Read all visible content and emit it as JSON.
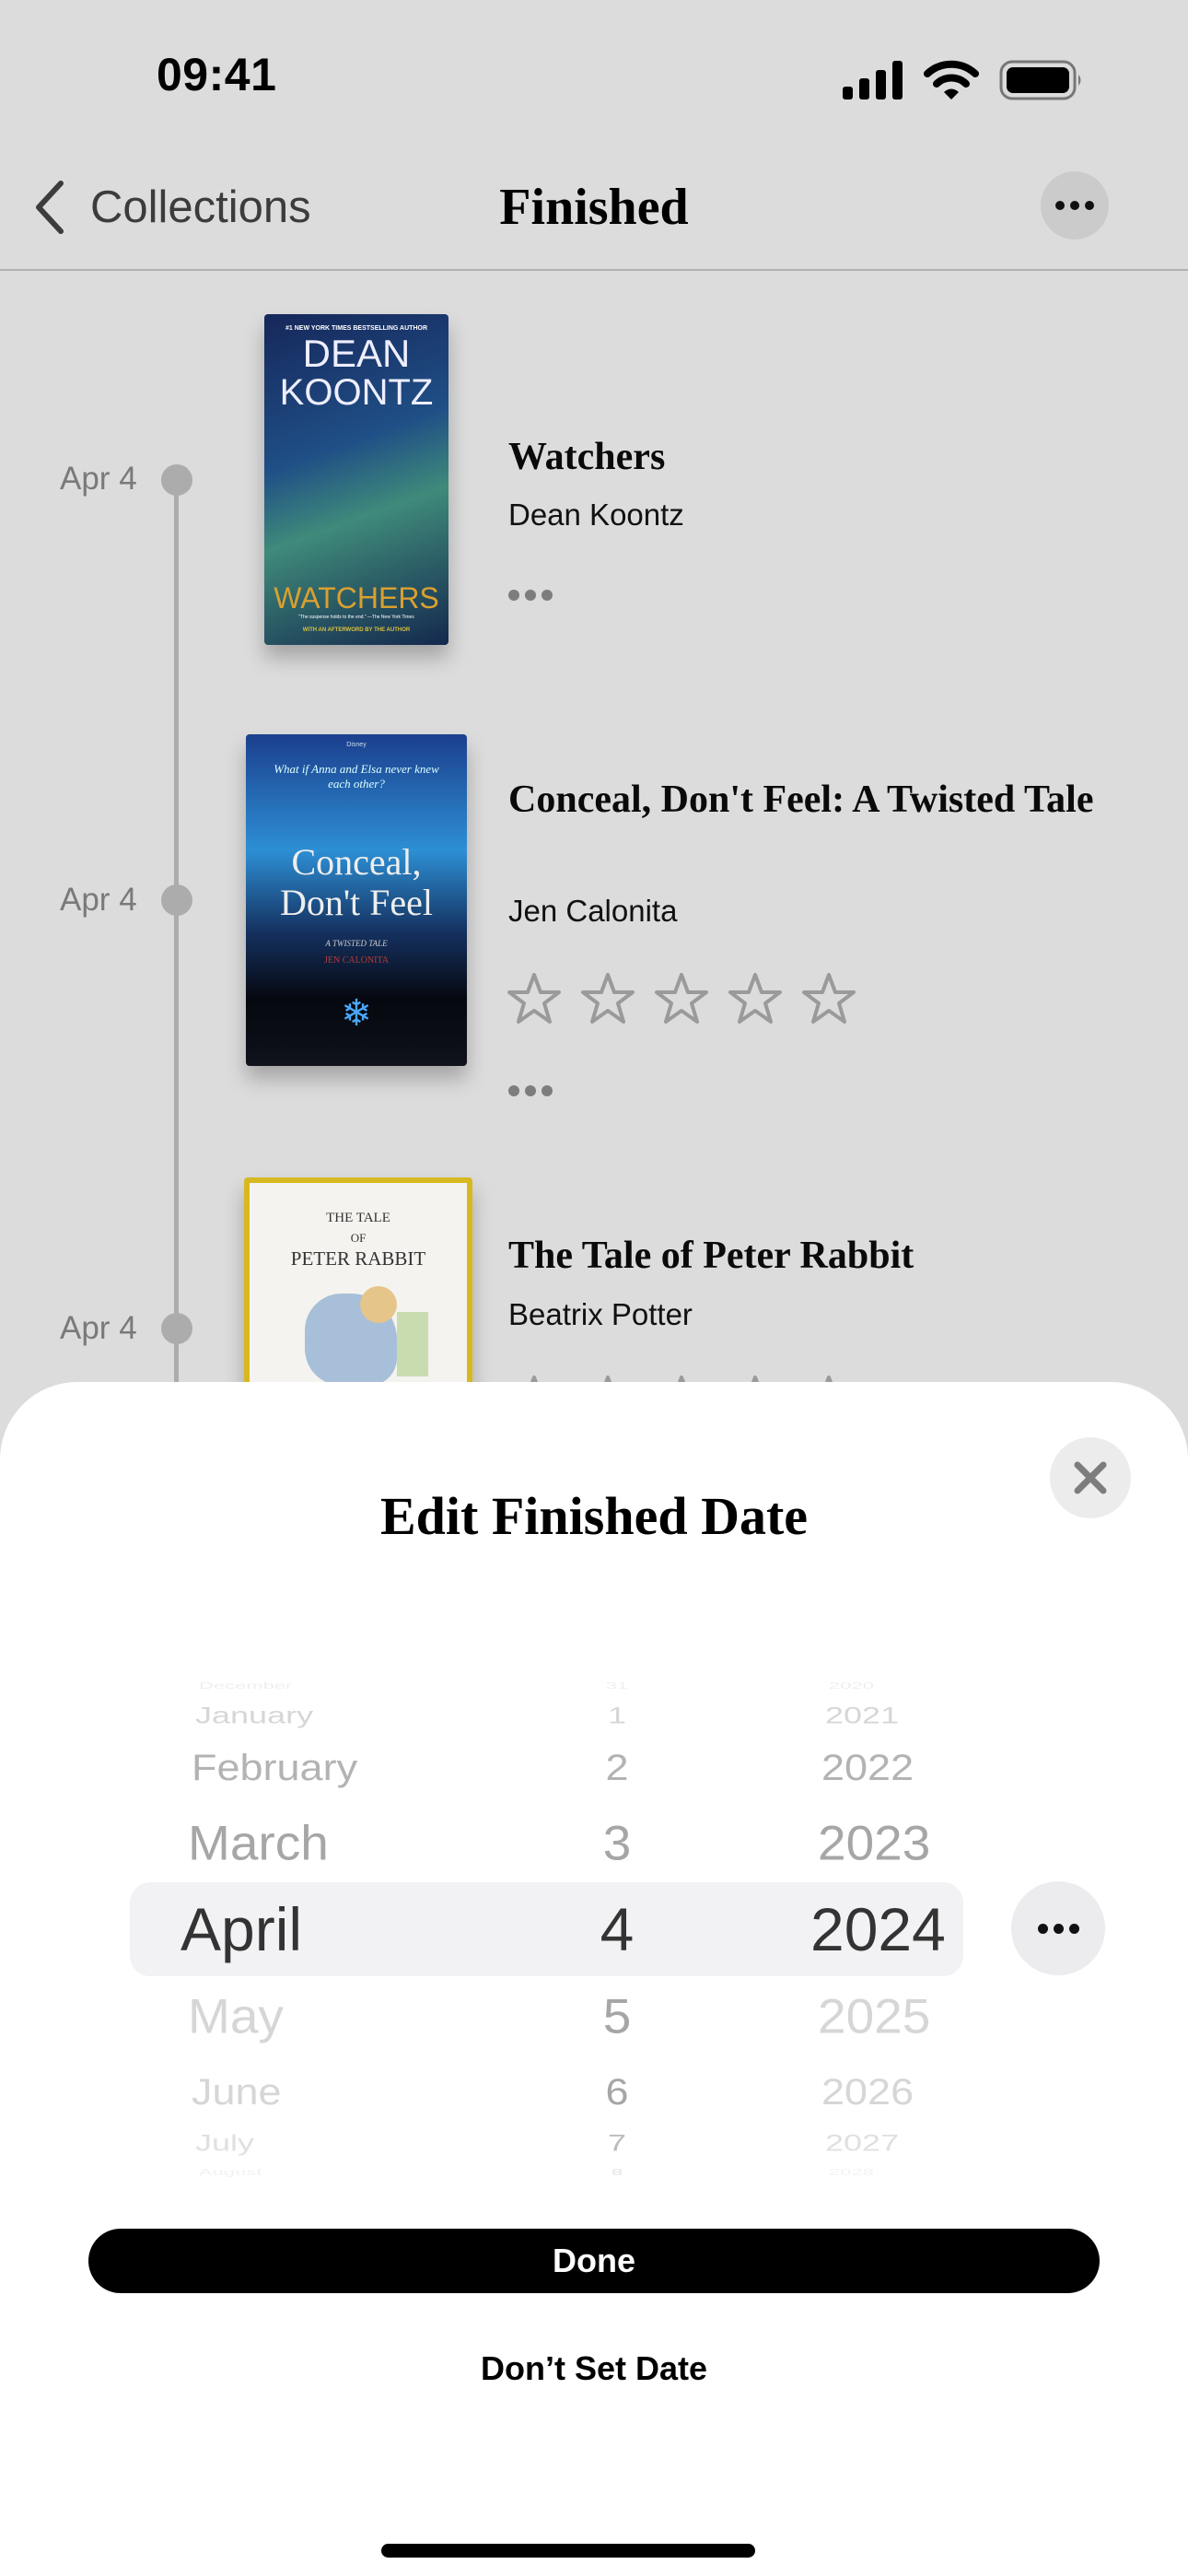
{
  "status_bar": {
    "time": "09:41",
    "icons": [
      "cellular-signal-icon",
      "wifi-icon",
      "battery-icon"
    ]
  },
  "nav": {
    "back_label": "Collections",
    "title": "Finished",
    "more_icon": "ellipsis-icon"
  },
  "books": [
    {
      "date": "Apr 4",
      "title": "Watchers",
      "author": "Dean Koontz",
      "rating": null,
      "cover": {
        "top_line": "#1 NEW YORK TIMES BESTSELLING AUTHOR",
        "author_line1": "DEAN",
        "author_line2": "KOONTZ",
        "title": "WATCHERS",
        "quote": "\"The suspense holds to the end.\" —The New York Times",
        "footer": "WITH AN AFTERWORD BY THE AUTHOR"
      }
    },
    {
      "date": "Apr 4",
      "title": "Conceal, Don't Feel: A Twisted Tale",
      "author": "Jen Calonita",
      "rating": 0,
      "max_rating": 5,
      "cover": {
        "brand": "Disney",
        "tagline": "What if Anna and Elsa never knew each other?",
        "title_line1": "Conceal,",
        "title_line2": "Don't Feel",
        "series": "A TWISTED TALE",
        "author": "JEN CALONITA"
      }
    },
    {
      "date": "Apr 4",
      "title": "The Tale of Peter Rabbit",
      "author": "Beatrix Potter",
      "rating": 0,
      "max_rating": 5,
      "cover": {
        "line1": "THE TALE",
        "line2": "OF",
        "line3": "PETER RABBIT"
      }
    }
  ],
  "sheet": {
    "title": "Edit Finished Date",
    "close_icon": "close-icon",
    "picker": {
      "months": [
        "December",
        "January",
        "February",
        "March",
        "April",
        "May",
        "June",
        "July",
        "August"
      ],
      "days": [
        "31",
        "1",
        "2",
        "3",
        "4",
        "5",
        "6",
        "7",
        "8"
      ],
      "years": [
        "2020",
        "2021",
        "2022",
        "2023",
        "2024",
        "2025",
        "2026",
        "2027",
        "2028"
      ],
      "selected": {
        "month": "April",
        "day": "4",
        "year": "2024"
      }
    },
    "picker_more_icon": "ellipsis-icon",
    "done_label": "Done",
    "dont_set_label": "Don’t Set Date"
  },
  "colors": {
    "background": "#dcdcdc",
    "sheet": "#ffffff",
    "primary_button": "#000000",
    "timeline": "#acacac"
  }
}
